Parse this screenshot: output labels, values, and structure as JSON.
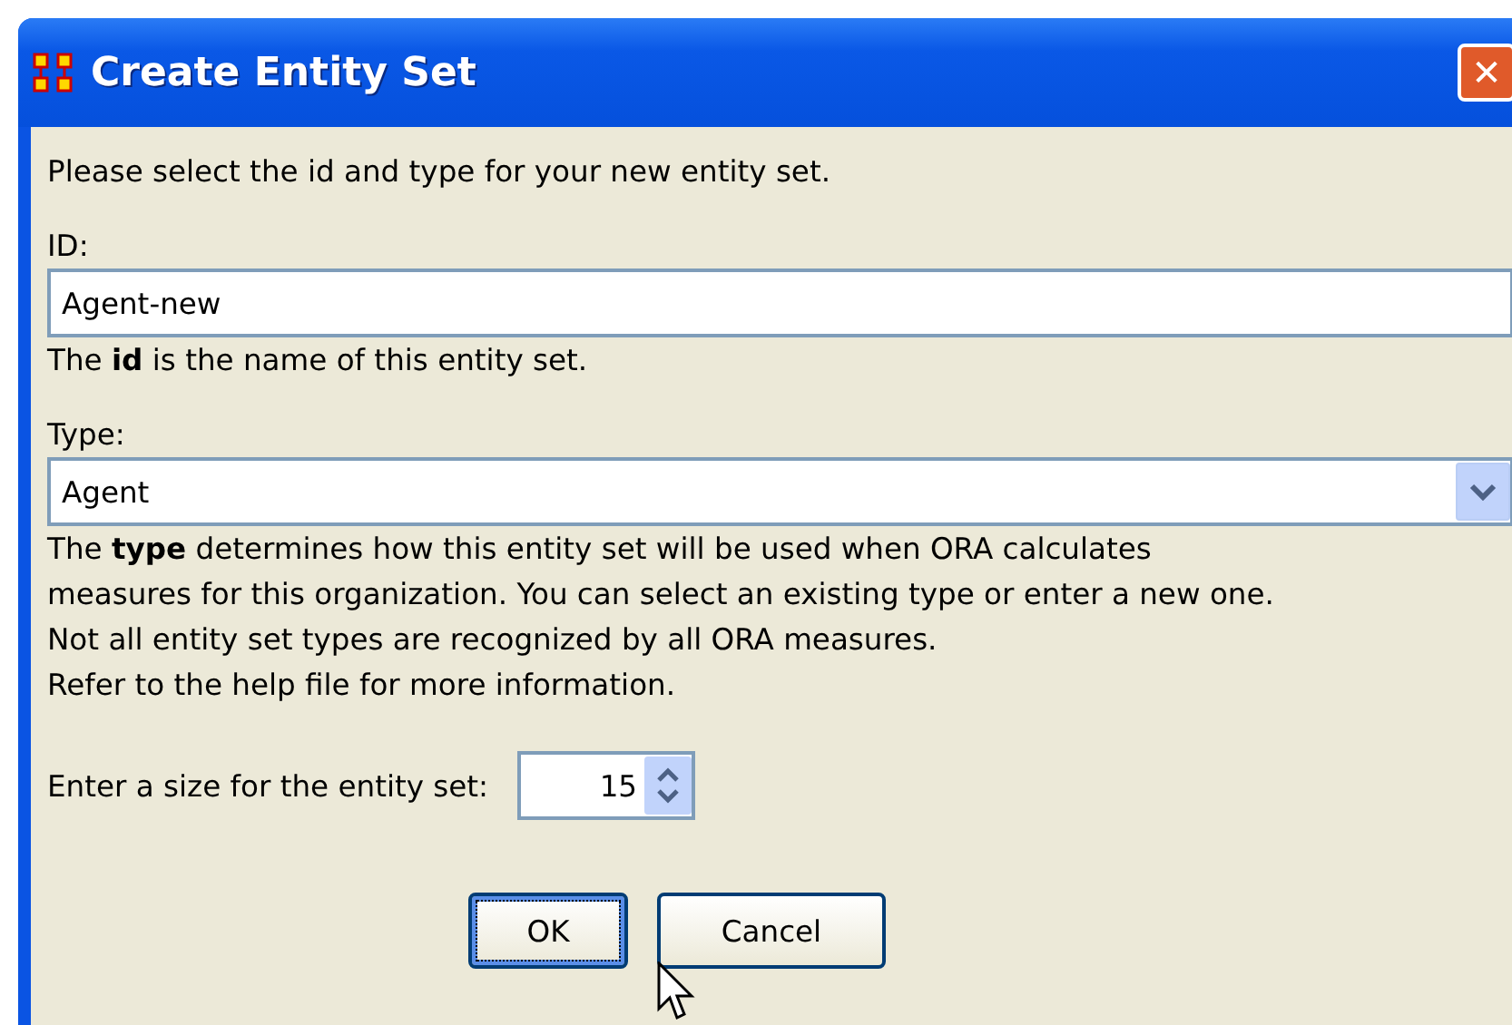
{
  "window": {
    "title": "Create Entity Set",
    "close_label": "✕"
  },
  "intro": "Please select the id and type for your new entity set.",
  "id_field": {
    "label": "ID:",
    "value": "Agent-new",
    "hint": "The **id** is the name of this entity set."
  },
  "type_field": {
    "label": "Type:",
    "value": "Agent",
    "help_lines": [
      "The **type** determines how this entity set will be used when ORA calculates",
      "measures for this organization. You can select an existing type or enter a new one.",
      "Not all entity set types are recognized by all ORA measures.",
      "Refer to the help file for more information."
    ]
  },
  "size_field": {
    "label": "Enter a size for the entity set:",
    "value": "15"
  },
  "buttons": [
    {
      "label": "OK",
      "focused": true
    },
    {
      "label": "Cancel",
      "focused": false
    }
  ]
}
